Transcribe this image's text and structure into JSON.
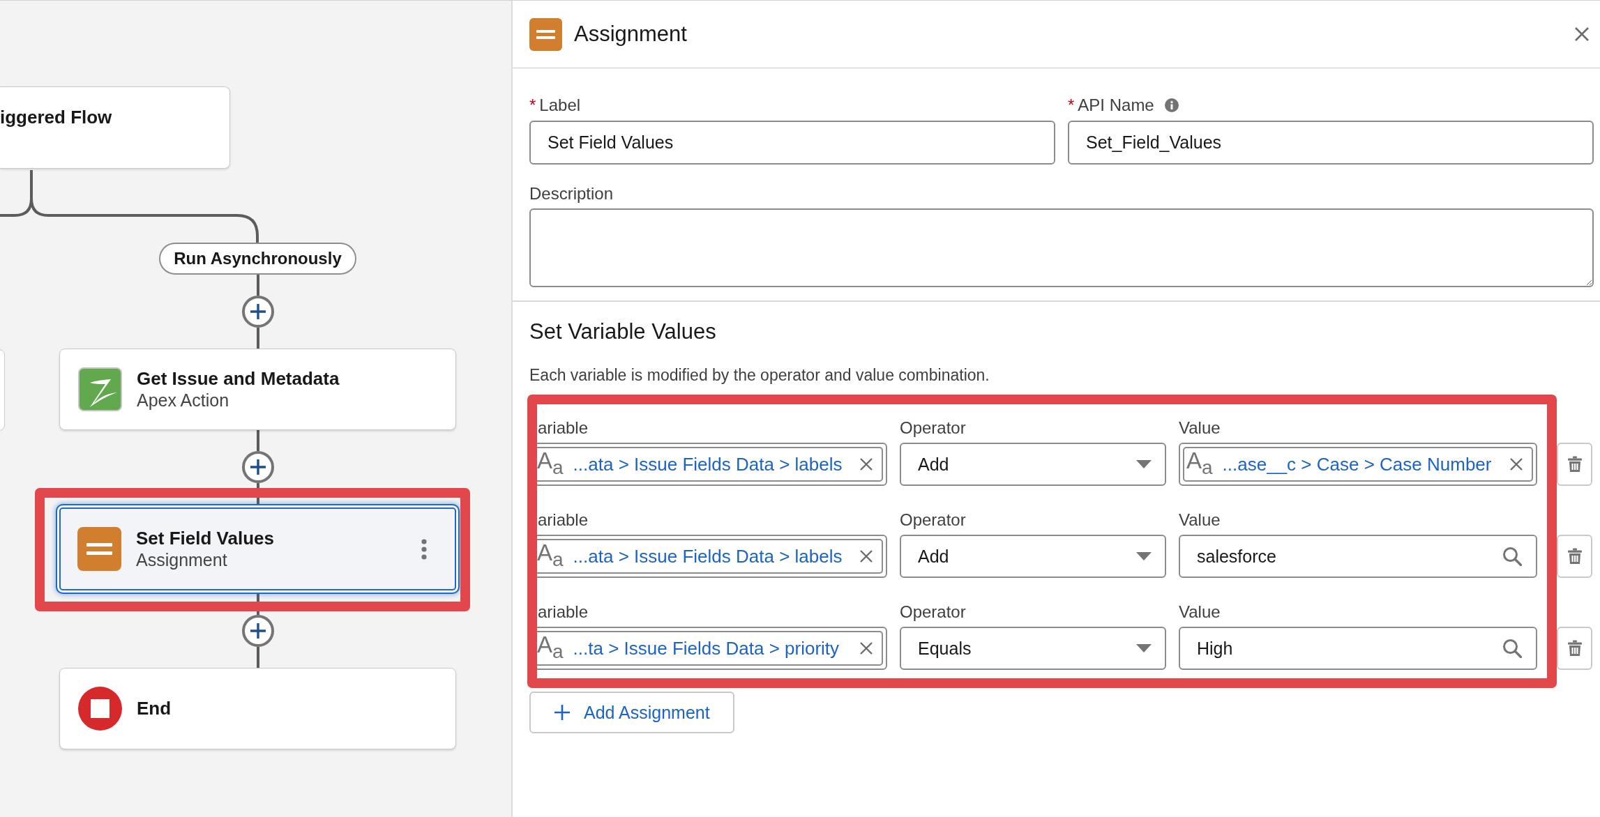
{
  "canvas": {
    "trigger_node": {
      "title": "iggered Flow"
    },
    "path_label": "Run Asynchronously",
    "nodes": [
      {
        "kind": "apex",
        "title": "Get Issue and Metadata",
        "subtitle": "Apex Action",
        "selected": false,
        "highlighted": false
      },
      {
        "kind": "assignment",
        "title": "Set Field Values",
        "subtitle": "Assignment",
        "selected": true,
        "highlighted": true
      },
      {
        "kind": "end",
        "title": "End",
        "selected": false,
        "highlighted": false
      }
    ]
  },
  "panel": {
    "title": "Assignment",
    "fields": [
      {
        "required_mark": "*",
        "label": "Label",
        "value": "Set Field Values"
      },
      {
        "required_mark": "*",
        "label": "API Name",
        "value": "Set_Field_Values",
        "info": true
      }
    ],
    "description": {
      "label": "Description"
    },
    "section_title": "Set Variable Values",
    "help_text": "Each variable is modified by the operator and value combination.",
    "assignments": {
      "highlighted": true,
      "rows": [
        {
          "variable_label": "ariable",
          "variable": {
            "type_glyph": "A$_{a}$",
            "text": "...ata > Issue Fields Data > labels"
          },
          "operator_label": "Operator",
          "operator": "Add",
          "value_label": "Value",
          "value": {
            "kind": "reference",
            "type_glyph": "A$_{a}$",
            "text": "...ase__c > Case > Case Number"
          }
        },
        {
          "variable_label": "ariable",
          "variable": {
            "type_glyph": "A$_{a}$",
            "text": "...ata > Issue Fields Data > labels"
          },
          "operator_label": "Operator",
          "operator": "Add",
          "value_label": "Value",
          "value": {
            "kind": "text",
            "text": "salesforce"
          }
        },
        {
          "variable_label": "ariable",
          "variable": {
            "type_glyph": "A$_{a}$",
            "text": "...ta > Issue Fields Data > priority"
          },
          "operator_label": "Operator",
          "operator": "Equals",
          "value_label": "Value",
          "value": {
            "kind": "text",
            "text": "High"
          }
        }
      ]
    },
    "add_button": "Add Assignment"
  }
}
